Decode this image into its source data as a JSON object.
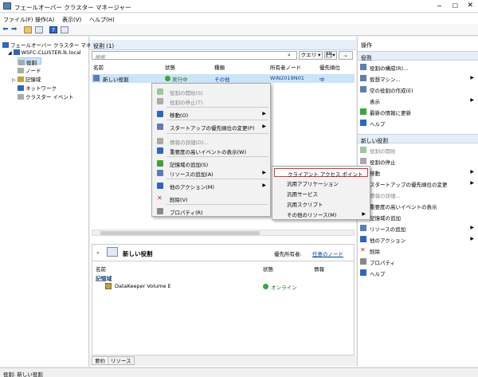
{
  "window": {
    "title": "フェールオーバー クラスター マネージャー"
  },
  "menu": [
    "ファイル(F)",
    "操作(A)",
    "表示(V)",
    "ヘルプ(H)"
  ],
  "tree": {
    "root": "フェールオーバー クラスター マネージャー",
    "cluster": "WSFC-CLUSTER.lk.local",
    "items": [
      "役割",
      "ノード",
      "記憶域",
      "ネットワーク",
      "クラスター イベント"
    ]
  },
  "roles": {
    "header": "役割 (1)",
    "search_placeholder": "検索",
    "query_label": "クエリ",
    "columns": [
      "名前",
      "状態",
      "種類",
      "所有者ノード",
      "優先順位"
    ],
    "rows": [
      {
        "name": "新しい役割",
        "status": "実行中",
        "type": "その他",
        "owner": "WIN2019N01",
        "priority": "中"
      }
    ]
  },
  "detail": {
    "title": "新しい役割",
    "owner_label": "優先所有者:",
    "owner_link": "任意のノード",
    "columns": [
      "名前",
      "状態",
      "情報"
    ],
    "group": "記憶域",
    "resource_name": "DataKeeper Volume E",
    "resource_status": "オンライン"
  },
  "tabs": [
    "要約",
    "リソース"
  ],
  "context_menu": [
    {
      "label": "役割の開始(S)",
      "disabled": true,
      "icon": "start-icon"
    },
    {
      "label": "役割の停止(T)",
      "disabled": true,
      "icon": "stop-icon"
    },
    {
      "label": "移動(O)",
      "disabled": false,
      "submenu": true,
      "icon": "move-icon"
    },
    {
      "label": "スタートアップの優先順位の変更(P)",
      "disabled": false,
      "submenu": true,
      "icon": "priority-icon"
    },
    {
      "label": "情報の詳細(D)...",
      "disabled": true,
      "icon": "info-icon"
    },
    {
      "label": "重要度の高いイベントの表示(W)",
      "disabled": false,
      "icon": "events-icon"
    },
    {
      "label": "記憶域の追加(S)",
      "disabled": false,
      "icon": "storage-icon"
    },
    {
      "label": "リソースの追加(A)",
      "disabled": false,
      "submenu": true,
      "icon": "add-resource-icon"
    },
    {
      "label": "他のアクション(M)",
      "disabled": false,
      "submenu": true,
      "icon": "more-icon"
    },
    {
      "label": "削除(V)",
      "disabled": false,
      "icon": "delete-icon"
    },
    {
      "label": "プロパティ(R)",
      "disabled": false,
      "icon": "properties-icon"
    }
  ],
  "submenu": [
    "クライアント アクセス ポイント",
    "汎用アプリケーション",
    "汎用サービス",
    "汎用スクリプト",
    "その他のリソース(M)"
  ],
  "actions": {
    "header": "操作",
    "section1": "役割",
    "items1": [
      {
        "label": "役割の構成(R)...",
        "submenu": false
      },
      {
        "label": "仮想マシン...",
        "submenu": true
      },
      {
        "label": "空の役割の作成(E)",
        "submenu": false
      },
      {
        "label": "表示",
        "submenu": true
      },
      {
        "label": "最新の情報に更新",
        "submenu": false
      },
      {
        "label": "ヘルプ",
        "submenu": false
      }
    ],
    "section2": "新しい役割",
    "items2": [
      {
        "label": "役割の開始",
        "disabled": true,
        "submenu": false
      },
      {
        "label": "役割の停止",
        "disabled": false,
        "submenu": false
      },
      {
        "label": "移動",
        "disabled": false,
        "submenu": true
      },
      {
        "label": "スタートアップの優先順位の変更",
        "disabled": false,
        "submenu": true
      },
      {
        "label": "情報の詳細...",
        "disabled": true,
        "submenu": false
      },
      {
        "label": "重要度の高いイベントの表示",
        "disabled": false,
        "submenu": false
      },
      {
        "label": "記憶域の追加",
        "disabled": false,
        "submenu": false
      },
      {
        "label": "リソースの追加",
        "disabled": false,
        "submenu": true
      },
      {
        "label": "他のアクション",
        "disabled": false,
        "submenu": true
      },
      {
        "label": "削除",
        "disabled": false,
        "submenu": false
      },
      {
        "label": "プロパティ",
        "disabled": false,
        "submenu": false
      },
      {
        "label": "ヘルプ",
        "disabled": false,
        "submenu": false
      }
    ]
  },
  "status": "役割: 新しい役割",
  "colors": {
    "accent": "#0045a8",
    "highlight_border": "#e0343a",
    "selection": "#cce4f7"
  }
}
